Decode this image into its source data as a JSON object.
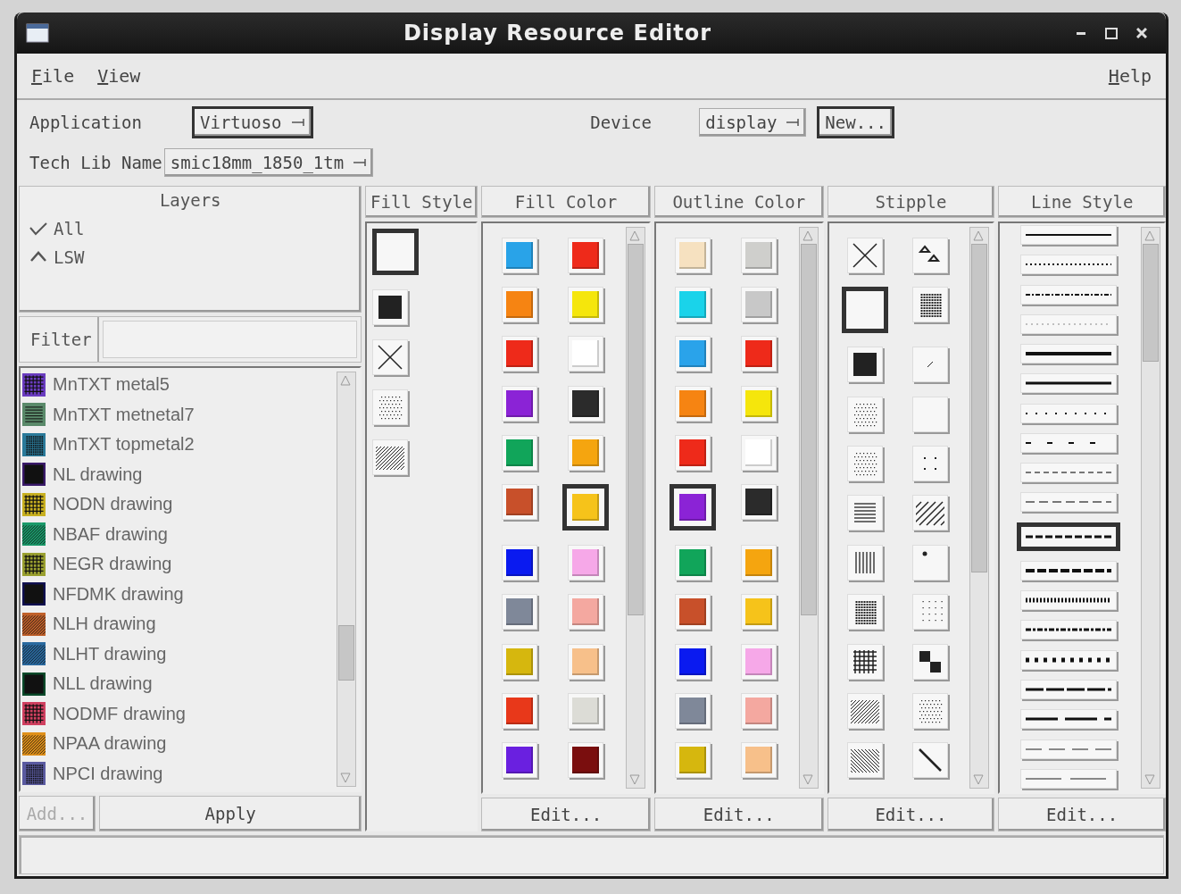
{
  "window": {
    "title": "Display Resource Editor"
  },
  "menu": [
    {
      "label": "File"
    },
    {
      "label": "View"
    },
    {
      "label": "Help"
    }
  ],
  "application": {
    "label": "Application",
    "value": "Virtuoso"
  },
  "device": {
    "label": "Device",
    "value": "display"
  },
  "new_button": "New...",
  "tech_lib": {
    "label": "Tech Lib Name",
    "value": "smic18mm_1850_1tm"
  },
  "layers": {
    "title": "Layers",
    "options": [
      {
        "label": "All",
        "kind": "check"
      },
      {
        "label": "LSW",
        "kind": "caret"
      }
    ],
    "filter": {
      "label": "Filter"
    },
    "items": [
      {
        "name": "MnTXT metal5",
        "color": "#6a3cc0",
        "kind": "grid"
      },
      {
        "name": "MnTXT metnetal7",
        "color": "#5a8a6a",
        "kind": "hlines"
      },
      {
        "name": "MnTXT topmetal2",
        "color": "#2a7a9a",
        "kind": "mesh"
      },
      {
        "name": "NL drawing",
        "color": "#3a1a6a",
        "kind": "solid"
      },
      {
        "name": "NODN drawing",
        "color": "#c8b020",
        "kind": "grid"
      },
      {
        "name": "NBAF drawing",
        "color": "#1a9a6a",
        "kind": "diag"
      },
      {
        "name": "NEGR drawing",
        "color": "#9aa030",
        "kind": "grid"
      },
      {
        "name": "NFDMK drawing",
        "color": "#101050",
        "kind": "solid"
      },
      {
        "name": "NLH drawing",
        "color": "#c0602a",
        "kind": "diag"
      },
      {
        "name": "NLHT drawing",
        "color": "#2a6aa0",
        "kind": "diag"
      },
      {
        "name": "NLL drawing",
        "color": "#0a4a2a",
        "kind": "solid"
      },
      {
        "name": "NODMF drawing",
        "color": "#d04060",
        "kind": "grid"
      },
      {
        "name": "NPAA drawing",
        "color": "#e0901a",
        "kind": "diag"
      },
      {
        "name": "NPCI drawing",
        "color": "#5a5aa0",
        "kind": "mesh"
      }
    ],
    "buttons": [
      {
        "label": "Add...",
        "disabled": true
      },
      {
        "label": "Apply",
        "disabled": false
      }
    ]
  },
  "fill_style": {
    "title": "Fill Style",
    "items": [
      {
        "kind": "blank",
        "selected": true
      },
      {
        "kind": "solid",
        "selected": false
      },
      {
        "kind": "cross",
        "selected": false
      },
      {
        "kind": "dots",
        "selected": false
      },
      {
        "kind": "diag",
        "selected": false
      }
    ]
  },
  "fill_color": {
    "title": "Fill Color",
    "edit": "Edit...",
    "swatches": [
      {
        "color": "#29a3e8",
        "selected": false
      },
      {
        "color": "#ee2a1a",
        "selected": false
      },
      {
        "color": "#f68412",
        "selected": false
      },
      {
        "color": "#f5e60c",
        "selected": false
      },
      {
        "color": "#ee2a1a",
        "selected": false
      },
      {
        "color": "#ffffff",
        "selected": false
      },
      {
        "color": "#8b23d6",
        "selected": false
      },
      {
        "color": "#2b2b2b",
        "selected": false
      },
      {
        "color": "#11a55a",
        "selected": false
      },
      {
        "color": "#f5a50f",
        "selected": false
      },
      {
        "color": "#c8502a",
        "selected": false
      },
      {
        "color": "#f6c31a",
        "selected": true
      },
      {
        "color": "#0a1af0",
        "selected": false
      },
      {
        "color": "#f6a8e8",
        "selected": false
      },
      {
        "color": "#7f8899",
        "selected": false
      },
      {
        "color": "#f4a8a0",
        "selected": false
      },
      {
        "color": "#d6b70e",
        "selected": false
      },
      {
        "color": "#f7c08a",
        "selected": false
      },
      {
        "color": "#e8381a",
        "selected": false
      },
      {
        "color": "#dcdcd6",
        "selected": false
      },
      {
        "color": "#6a20e0",
        "selected": false
      },
      {
        "color": "#7a0e0e",
        "selected": false
      }
    ]
  },
  "outline_color": {
    "title": "Outline Color",
    "edit": "Edit...",
    "swatches": [
      {
        "color": "#f6e1c0",
        "selected": false
      },
      {
        "color": "#cfcfcc",
        "selected": false
      },
      {
        "color": "#1ad3ea",
        "selected": false
      },
      {
        "color": "#c8c8c8",
        "selected": false
      },
      {
        "color": "#2aa3ea",
        "selected": false
      },
      {
        "color": "#ee2a1a",
        "selected": false
      },
      {
        "color": "#f68412",
        "selected": false
      },
      {
        "color": "#f5e60c",
        "selected": false
      },
      {
        "color": "#ee2a1a",
        "selected": false
      },
      {
        "color": "#ffffff",
        "selected": false
      },
      {
        "color": "#8b23d6",
        "selected": true
      },
      {
        "color": "#2b2b2b",
        "selected": false
      },
      {
        "color": "#11a55a",
        "selected": false
      },
      {
        "color": "#f5a50f",
        "selected": false
      },
      {
        "color": "#c8502a",
        "selected": false
      },
      {
        "color": "#f6c31a",
        "selected": false
      },
      {
        "color": "#0a1af0",
        "selected": false
      },
      {
        "color": "#f6a8e8",
        "selected": false
      },
      {
        "color": "#7f8899",
        "selected": false
      },
      {
        "color": "#f4a8a0",
        "selected": false
      },
      {
        "color": "#d6b70e",
        "selected": false
      },
      {
        "color": "#f7c08a",
        "selected": false
      }
    ]
  },
  "stipple": {
    "title": "Stipple",
    "edit": "Edit...",
    "items": [
      {
        "kind": "cross",
        "selected": false
      },
      {
        "kind": "triangles",
        "selected": false
      },
      {
        "kind": "blank",
        "selected": true
      },
      {
        "kind": "mesh",
        "selected": false
      },
      {
        "kind": "solid",
        "selected": false
      },
      {
        "kind": "speck",
        "selected": false
      },
      {
        "kind": "dots",
        "selected": false
      },
      {
        "kind": "blank",
        "selected": false
      },
      {
        "kind": "dots",
        "selected": false
      },
      {
        "kind": "fourdots",
        "selected": false
      },
      {
        "kind": "hlines",
        "selected": false
      },
      {
        "kind": "widediag",
        "selected": false
      },
      {
        "kind": "vlines",
        "selected": false
      },
      {
        "kind": "dot",
        "selected": false
      },
      {
        "kind": "mesh",
        "selected": false
      },
      {
        "kind": "scatter",
        "selected": false
      },
      {
        "kind": "grid",
        "selected": false
      },
      {
        "kind": "checker",
        "selected": false
      },
      {
        "kind": "diag",
        "selected": false
      },
      {
        "kind": "dots",
        "selected": false
      },
      {
        "kind": "backdiag",
        "selected": false
      },
      {
        "kind": "slash",
        "selected": false
      }
    ]
  },
  "line_style": {
    "title": "Line Style",
    "edit": "Edit...",
    "items": [
      {
        "kind": "solid",
        "selected": false
      },
      {
        "kind": "dotted",
        "selected": false
      },
      {
        "kind": "dashdot",
        "selected": false
      },
      {
        "kind": "fine",
        "selected": false
      },
      {
        "kind": "thick",
        "selected": false
      },
      {
        "kind": "medium",
        "selected": false
      },
      {
        "kind": "sparse",
        "selected": false
      },
      {
        "kind": "gapped",
        "selected": false
      },
      {
        "kind": "dash",
        "selected": false
      },
      {
        "kind": "dashlong",
        "selected": false
      },
      {
        "kind": "heavydash",
        "selected": true
      },
      {
        "kind": "heavy",
        "selected": false
      },
      {
        "kind": "ticks",
        "selected": false
      },
      {
        "kind": "dashdot2",
        "selected": false
      },
      {
        "kind": "bigdots",
        "selected": false
      },
      {
        "kind": "longdash",
        "selected": false
      },
      {
        "kind": "longer",
        "selected": false
      },
      {
        "kind": "graydash",
        "selected": false
      },
      {
        "kind": "graylong",
        "selected": false
      }
    ]
  }
}
